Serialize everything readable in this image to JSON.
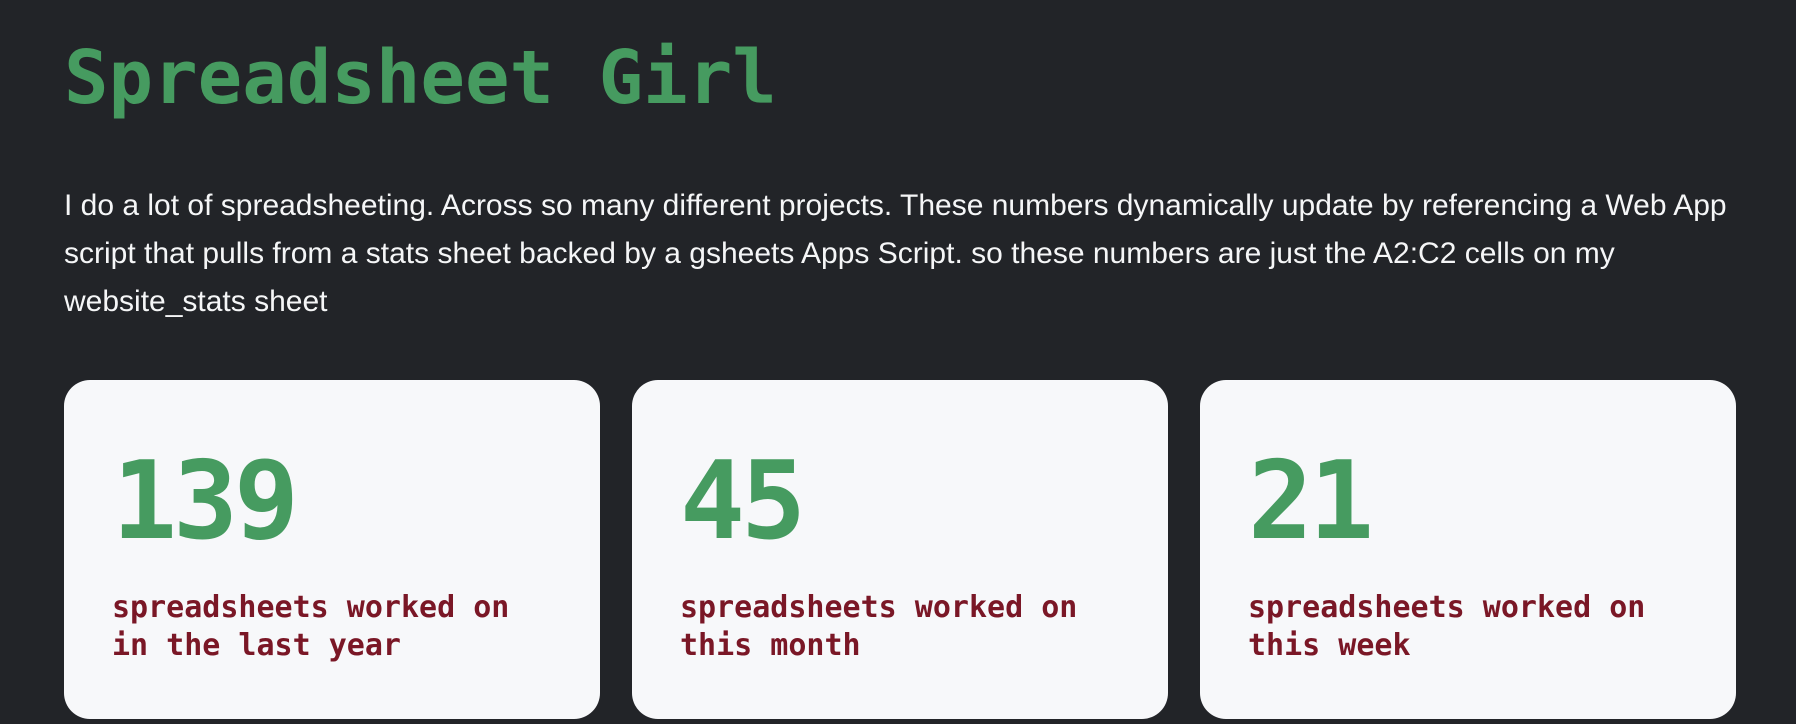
{
  "header": {
    "title": "Spreadsheet Girl"
  },
  "intro": {
    "text": "I do a lot of spreadsheeting. Across so many different projects. These numbers dynamically update by referencing a Web App script that pulls from a stats sheet backed by a gsheets Apps Script. so these numbers are just the A2:C2 cells on my website_stats sheet"
  },
  "stats": [
    {
      "value": "139",
      "label": "spreadsheets worked on in the last year"
    },
    {
      "value": "45",
      "label": "spreadsheets worked on this month"
    },
    {
      "value": "21",
      "label": "spreadsheets worked on this week"
    }
  ],
  "colors": {
    "background": "#222428",
    "accent_green": "#469b60",
    "label_maroon": "#7a1726",
    "card_background": "#f7f8fa"
  }
}
